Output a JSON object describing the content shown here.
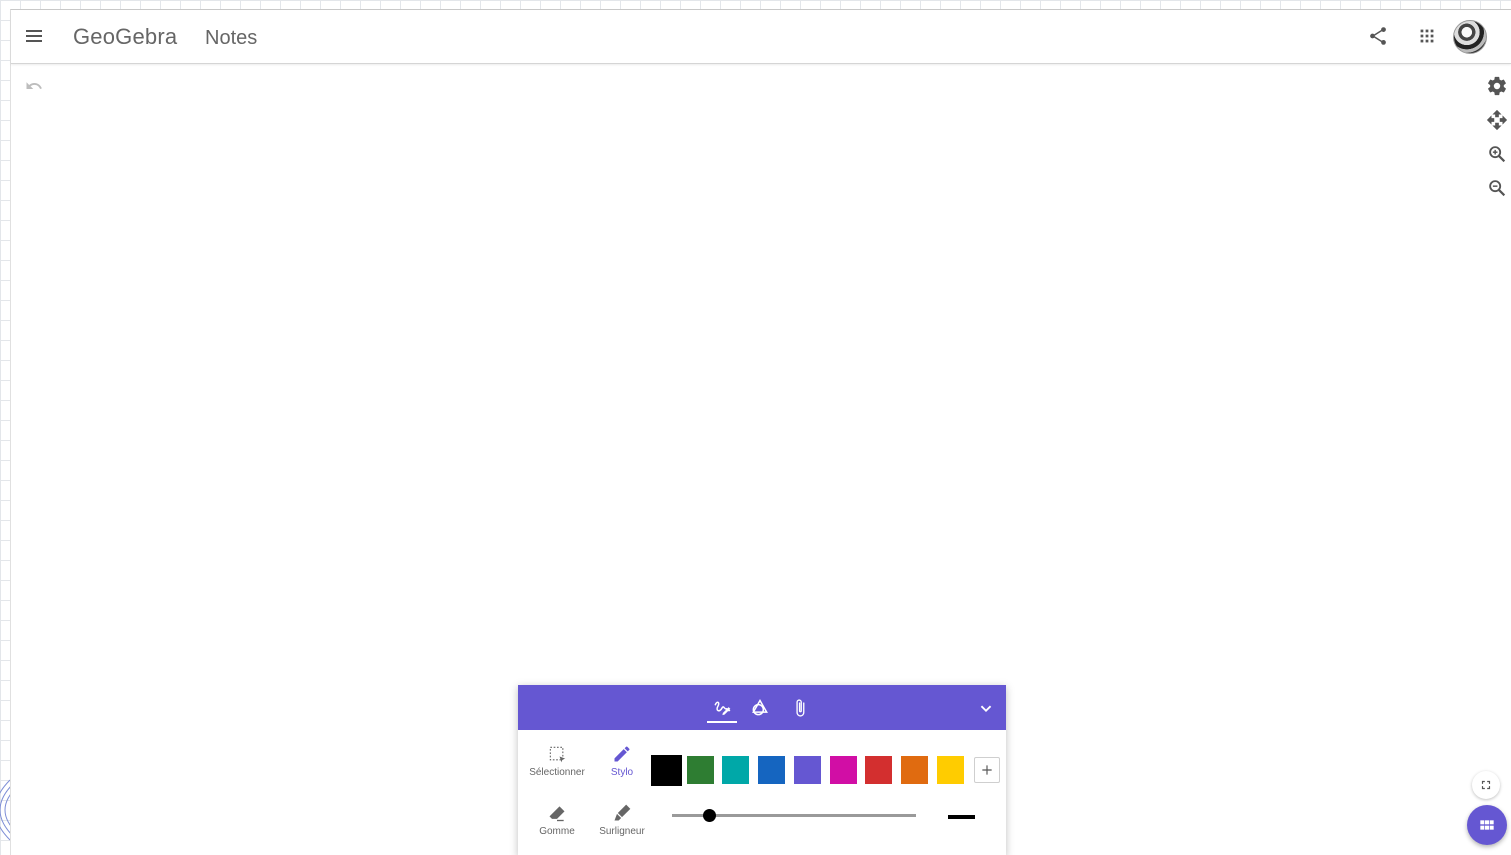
{
  "header": {
    "logo_text": "GeoGebra",
    "app_name": "Notes"
  },
  "icons": {
    "menu": "hamburger-menu-icon",
    "share": "share-icon",
    "apps": "apps-grid-icon",
    "undo": "undo-icon",
    "settings": "gear-icon",
    "move": "move-arrows-icon",
    "zoom_in": "zoom-in-icon",
    "zoom_out": "zoom-out-icon",
    "fullscreen": "fullscreen-icon",
    "fab": "grid-icon"
  },
  "toolbox": {
    "accent": "#6557d2",
    "tabs": [
      "pen-tab",
      "shapes-tab",
      "attachment-tab"
    ],
    "active_tab": "pen-tab",
    "tools": {
      "select_label": "Sélectionner",
      "pen_label": "Stylo",
      "eraser_label": "Gomme",
      "highlighter_label": "Surligneur"
    },
    "active_tool": "Stylo",
    "colors": [
      "#000000",
      "#2e7d32",
      "#00a8a8",
      "#1565c0",
      "#6557d2",
      "#d10ea5",
      "#d32f2f",
      "#e06b10",
      "#ffcc00"
    ],
    "selected_color": "#000000",
    "pen_size_fraction": 0.15
  }
}
